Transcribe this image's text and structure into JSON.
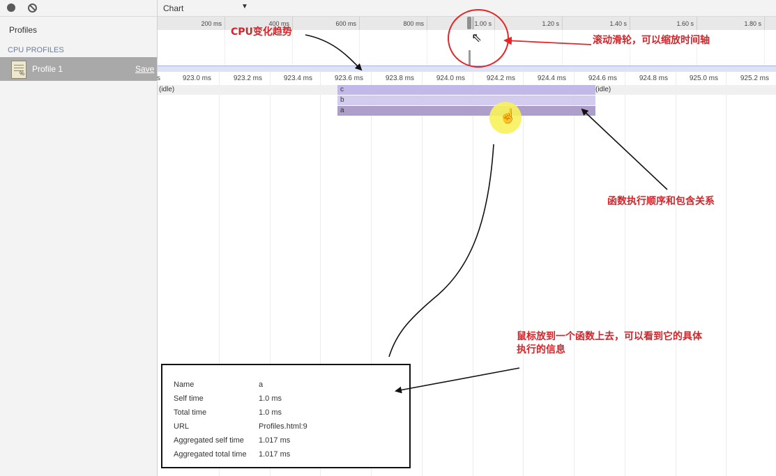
{
  "sidebar": {
    "title": "Profiles",
    "section_header": "CPU PROFILES",
    "profile_name": "Profile 1",
    "save_label": "Save",
    "icons": [
      "record-icon",
      "clear-icon",
      "profile-file-icon"
    ]
  },
  "toolbar": {
    "view_mode": "Chart",
    "dropdown_icon": "triangle-down"
  },
  "overview_ruler": {
    "labels": [
      "200 ms",
      "400 ms",
      "600 ms",
      "800 ms",
      "1.00 s",
      "1.20 s",
      "1.40 s",
      "1.60 s",
      "1.80 s"
    ]
  },
  "detail_ruler": {
    "labels": [
      "s",
      "923.0 ms",
      "923.2 ms",
      "923.4 ms",
      "923.6 ms",
      "923.8 ms",
      "924.0 ms",
      "924.2 ms",
      "924.4 ms",
      "924.6 ms",
      "924.8 ms",
      "925.0 ms",
      "925.2 ms"
    ]
  },
  "flame": {
    "idle_left": "(idle)",
    "idle_right": "(idle)",
    "frames": [
      "c",
      "b",
      "a"
    ]
  },
  "tooltip": {
    "rows": [
      {
        "key": "Name",
        "value": "a"
      },
      {
        "key": "Self time",
        "value": "1.0 ms"
      },
      {
        "key": "Total time",
        "value": "1.0 ms"
      },
      {
        "key": "URL",
        "value": "Profiles.html:9"
      },
      {
        "key": "Aggregated self time",
        "value": "1.017 ms"
      },
      {
        "key": "Aggregated total time",
        "value": "1.017 ms"
      }
    ]
  },
  "annotations": {
    "cpu_trend": "CPU变化趋势",
    "scroll_zoom": "滚动滑轮，可以缩放时间轴",
    "call_order": "函数执行顺序和包含关系",
    "hover_info_line1": "鼠标放到一个函数上去，可以看到它的具体",
    "hover_info_line2": "执行的信息"
  },
  "colors": {
    "annotation_red": "#d0262b",
    "frame_c": "#c2b9e8",
    "frame_b": "#d3ccee",
    "frame_a": "#ad9fc9",
    "selected_row": "#a9a9a9"
  }
}
